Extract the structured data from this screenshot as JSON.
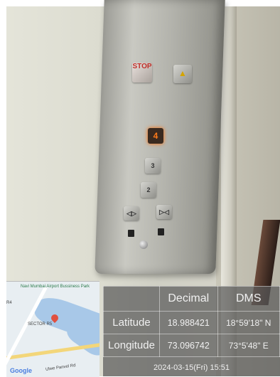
{
  "panel": {
    "stop_label": "STOP",
    "lit_floor": "4",
    "floor_3": "3",
    "floor_2": "2",
    "open_symbol": "◁▷",
    "close_symbol": "▷◁"
  },
  "map": {
    "place_label": "Navi Mumbai Airport Bussiness Park",
    "sector_label": "SECTOR R5",
    "road_label": "Ulwe Panvel Rd",
    "edge_label": "R4",
    "brand": "Google"
  },
  "geo": {
    "col_decimal": "Decimal",
    "col_dms": "DMS",
    "lat_label": "Latitude",
    "lat_decimal": "18.988421",
    "lat_dms": "18°59'18\" N",
    "lon_label": "Longitude",
    "lon_decimal": "73.096742",
    "lon_dms": "73°5'48\" E",
    "timestamp": "2024-03-15(Fri)  15:51"
  }
}
